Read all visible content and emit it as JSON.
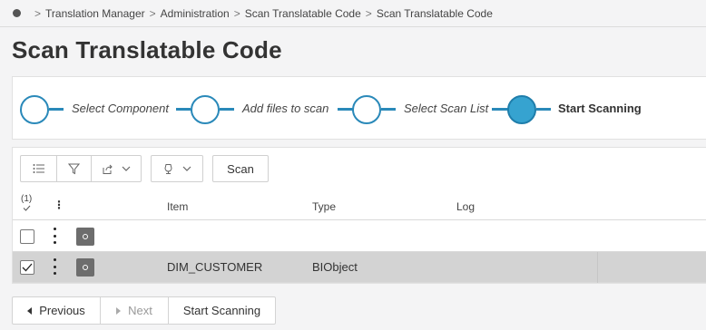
{
  "breadcrumb": {
    "items": [
      "Translation Manager",
      "Administration",
      "Scan Translatable Code",
      "Scan Translatable Code"
    ]
  },
  "page_title": "Scan Translatable Code",
  "wizard": {
    "steps": [
      {
        "label": "Select Component",
        "active": false
      },
      {
        "label": "Add files to scan",
        "active": false
      },
      {
        "label": "Select Scan List",
        "active": false
      },
      {
        "label": "Start Scanning",
        "active": true
      }
    ],
    "accent_color": "#2a89b9",
    "active_fill": "#36a3d0"
  },
  "toolbar": {
    "icons": [
      "list-icon",
      "filter-icon",
      "export-icon",
      "chevron-down-icon",
      "settings-icon",
      "chevron-down-icon"
    ],
    "scan_label": "Scan"
  },
  "grid": {
    "selected_count": "(1)",
    "columns": [
      "Item",
      "Type",
      "Log"
    ],
    "rows": [
      {
        "item": "",
        "type": "",
        "log": "",
        "selected": false
      },
      {
        "item": "DIM_CUSTOMER",
        "type": "BIObject",
        "log": "",
        "selected": true
      }
    ]
  },
  "footer": {
    "previous_label": "Previous",
    "next_label": "Next",
    "start_label": "Start Scanning"
  }
}
